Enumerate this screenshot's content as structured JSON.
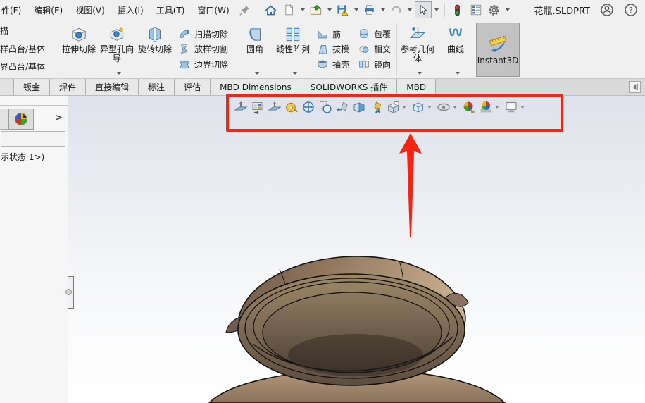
{
  "window": {
    "title": "花瓶.SLDPRT"
  },
  "menubar": {
    "items": [
      "件(F)",
      "编辑(E)",
      "视图(V)",
      "插入(I)",
      "工具(T)",
      "窗口(W)"
    ]
  },
  "quickbar": {
    "icons": [
      "pin-icon",
      "home-icon",
      "new-document-icon",
      "open-icon",
      "save-icon",
      "print-icon",
      "undo-icon",
      "select-arrow-icon",
      "rebuild-traffic-light-icon",
      "task-properties-icon",
      "options-gear-icon",
      "user-account-icon",
      "help-icon"
    ]
  },
  "ribbon": {
    "cut_labels": [
      "描",
      "样凸台/基体",
      "界凸台/基体"
    ],
    "buttons": {
      "extruded_cut": "拉伸切除",
      "hole_wizard": "异型孔向导",
      "revolved_cut": "旋转切除",
      "swept_cut": "扫描切除",
      "lofted_cut": "放样切割",
      "boundary_cut": "边界切除",
      "fillet": "圆角",
      "linear_pattern": "线性阵列",
      "rib": "筋",
      "draft": "拔模",
      "shell": "抽壳",
      "wrap": "包覆",
      "intersect": "相交",
      "mirror": "镜向",
      "reference_geometry": "参考几何体",
      "curves": "曲线",
      "instant3d": "Instant3D"
    }
  },
  "tabs": {
    "items": [
      "钣金",
      "焊件",
      "直接编辑",
      "标注",
      "评估",
      "MBD Dimensions",
      "SOLIDWORKS 插件",
      "MBD"
    ]
  },
  "panel": {
    "active_tab_icon": "display-manager-color-wheel-icon",
    "expand_arrow": ">",
    "filter_value": "",
    "filter_placeholder": "",
    "tree_text": "示状态 1>)"
  },
  "headsup": {
    "buttons": [
      {
        "name": "3d-view-icon",
        "dropdown": false
      },
      {
        "name": "capture-3d-view-icon",
        "dropdown": false
      },
      {
        "name": "normal-to-icon",
        "dropdown": false
      },
      {
        "name": "measure-icon",
        "dropdown": false
      },
      {
        "name": "zoom-to-fit-icon",
        "dropdown": false
      },
      {
        "name": "zoom-to-area-icon",
        "dropdown": false
      },
      {
        "name": "previous-view-icon",
        "dropdown": false
      },
      {
        "name": "section-view-icon",
        "dropdown": false
      },
      {
        "name": "dynamic-annotation-views-icon",
        "dropdown": false
      },
      {
        "name": "view-orientation-icon",
        "dropdown": true
      },
      {
        "name": "display-style-icon",
        "dropdown": true
      },
      {
        "name": "hide-show-items-icon",
        "dropdown": true
      },
      {
        "name": "edit-appearance-icon",
        "dropdown": false
      },
      {
        "name": "apply-scene-icon",
        "dropdown": true
      },
      {
        "name": "view-settings-icon",
        "dropdown": true
      }
    ]
  },
  "annotation": {
    "highlight_color": "#f42613",
    "shape": "red box around heads-up view toolbar with red arrow pointing up at it"
  },
  "colors": {
    "accent_blue": "#3a85c8",
    "bronze_model": "#a18a6c",
    "viewport_top": "#dfe2ea",
    "chrome_gray": "#f0f0f0"
  }
}
